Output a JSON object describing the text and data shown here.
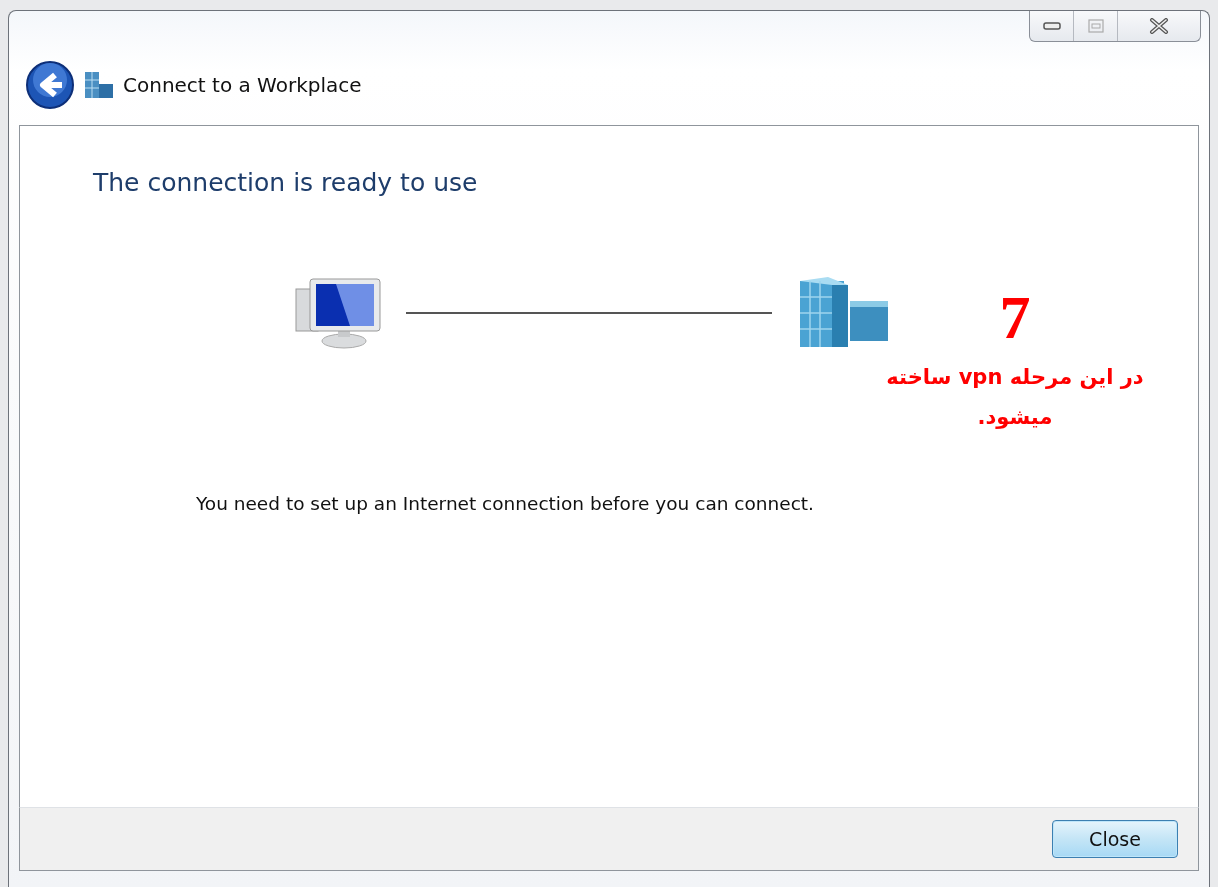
{
  "window": {
    "title": "Connect to a Workplace"
  },
  "heading": "The connection is ready to use",
  "message": "You need to set up an Internet connection before you can connect.",
  "annotation": {
    "step": "7",
    "note": "در این مرحله vpn ساخته میشود."
  },
  "buttons": [
    {
      "label": "Close"
    }
  ]
}
